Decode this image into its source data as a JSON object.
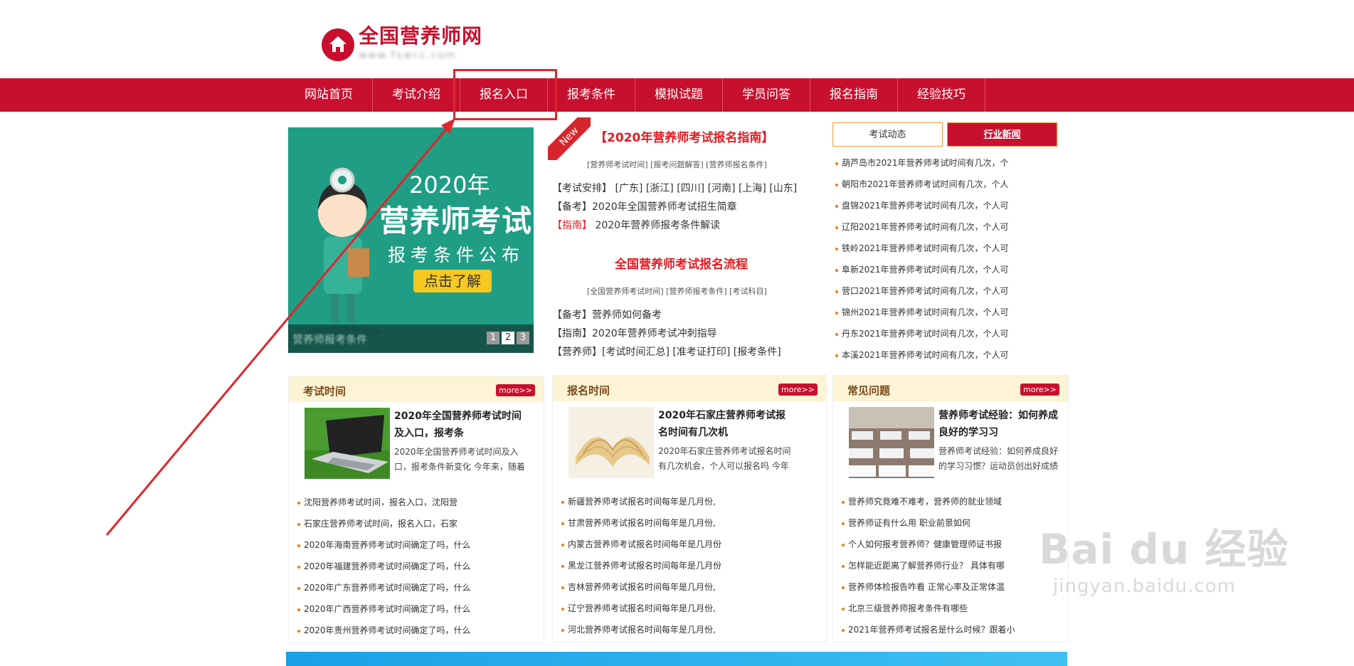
{
  "header": {
    "site_title": "全国营养师网",
    "site_url": "www.fxwcc.com"
  },
  "nav": {
    "items": [
      "网站首页",
      "考试介绍",
      "报名入口",
      "报考条件",
      "模拟试题",
      "学员问答",
      "报名指南",
      "经验技巧"
    ]
  },
  "banner": {
    "year": "2020年",
    "title": "营养师考试",
    "subtitle": "报考条件公布",
    "button": "点击了解",
    "caption": "营养师报考条件",
    "pages": [
      "1",
      "2",
      "3"
    ],
    "active_page": 2
  },
  "middle": {
    "ribbon": "New",
    "heading1": "【2020年营养师考试报名指南】",
    "links1": "[营养师考试时间] [报考问题解答] [营养师报名条件]",
    "line1": "【考试安排】 [广东] [浙江] [四川] [河南] [上海] [山东]",
    "line2_tag": "【备考】",
    "line2_text": "2020年全国营养师考试招生简章",
    "line3_tag": "【指南】",
    "line3_text": "2020年营养师报考条件解读",
    "heading2": "全国营养师考试报名流程",
    "links2": "[全国营养师考试时间] [营养师报考条件] [考试科目]",
    "line4": "【备考】营养师如何备考",
    "line5": "【指南】2020年营养师考试冲刺指导",
    "line6": "【营养师】[考试时间汇总] [准考证打印] [报考条件]"
  },
  "news": {
    "tabs": [
      "考试动态",
      "行业新闻"
    ],
    "items": [
      "葫芦岛市2021年营养师考试时间有几次，个",
      "朝阳市2021年营养师考试时间有几次，个人",
      "盘锦2021年营养师考试时间有几次，个人可",
      "辽阳2021年营养师考试时间有几次，个人可",
      "铁岭2021年营养师考试时间有几次，个人可",
      "阜新2021年营养师考试时间有几次，个人可",
      "营口2021年营养师考试时间有几次，个人可",
      "锦州2021年营养师考试时间有几次，个人可",
      "丹东2021年营养师考试时间有几次，个人可",
      "本溪2021年营养师考试时间有几次，个人可"
    ]
  },
  "boxes": [
    {
      "title": "考试时间",
      "more": "more>>",
      "feat_title": "2020年全国营养师考试时间及入口，报考条",
      "feat_desc": "2020年全国营养师考试时间及入口，报考条件新变化 今年来，随着",
      "items": [
        "沈阳营养师考试时间，报名入口，沈阳营",
        "石家庄营养师考试时间，报名入口，石家",
        "2020年海南营养师考试时间确定了吗，什么",
        "2020年福建营养师考试时间确定了吗，什么",
        "2020年广东营养师考试时间确定了吗，什么",
        "2020年广西营养师考试时间确定了吗，什么",
        "2020年贵州营养师考试时间确定了吗，什么"
      ]
    },
    {
      "title": "报名时间",
      "more": "more>>",
      "feat_title": "2020年石家庄营养师考试报名时间有几次机",
      "feat_desc": "2020年石家庄营养师考试报名时间有几次机会，个人可以报名吗 今年",
      "items": [
        "新疆营养师考试报名时间每年是几月份,",
        "甘肃营养师考试报名时间每年是几月份,",
        "内蒙古营养师考试报名时间每年是几月份",
        "黑龙江营养师考试报名时间每年是几月份",
        "吉林营养师考试报名时间每年是几月份,",
        "辽宁营养师考试报名时间每年是几月份,",
        "河北营养师考试报名时间每年是几月份,"
      ]
    },
    {
      "title": "常见问题",
      "more": "more>>",
      "feat_title": "营养师考试经验：如何养成良好的学习习",
      "feat_desc": "营养师考试经验：如何养成良好的学习习惯？运动员创出好成绩",
      "items": [
        "营养师究竟难不难考，营养师的就业领域",
        "营养师证有什么用 职业前景如何",
        "个人如何报考营养师？健康管理师证书报",
        "怎样能近距离了解营养师行业？ 具体有哪",
        "营养师体检报告咋看 正常心率及正常体温",
        "北京三级营养师报考条件有哪些",
        "2021年营养师考试报名是什么时候？跟着小"
      ]
    }
  ],
  "watermark": {
    "brand": "Bai du 经验",
    "url": "jingyan.baidu.com"
  },
  "colors": {
    "brand_red": "#c8102e",
    "title_red": "#e21c22",
    "banner_teal": "#1f9e85",
    "accent_orange": "#f07c00",
    "box_header": "#fdf3d5"
  }
}
